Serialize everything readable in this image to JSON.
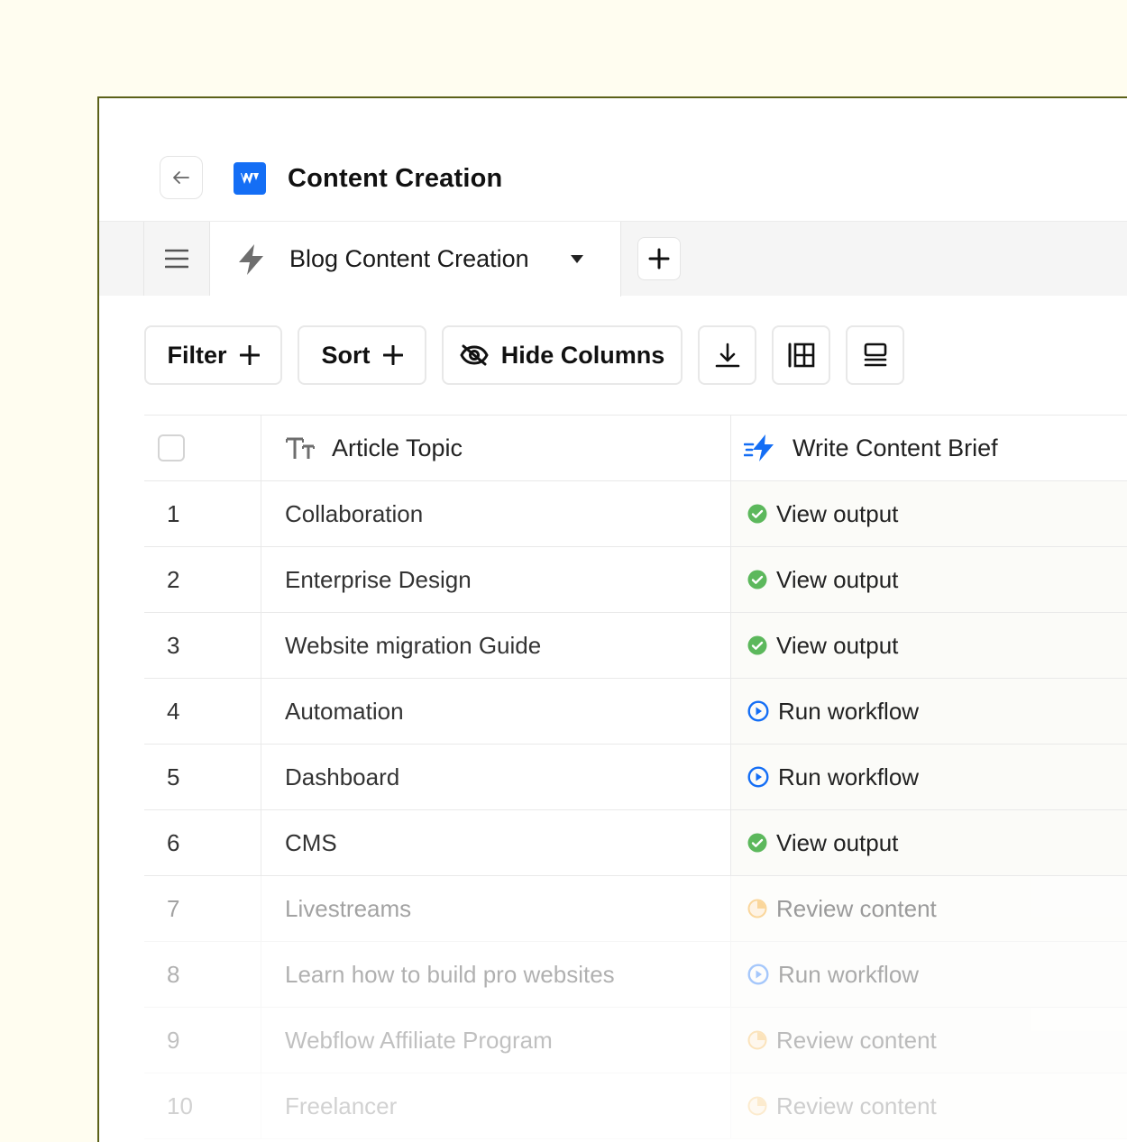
{
  "header": {
    "back_icon": "arrow-left-icon",
    "logo_icon": "webflow-logo-icon",
    "title": "Content Creation"
  },
  "tabs": {
    "menu_icon": "hamburger-menu-icon",
    "active": {
      "icon": "bolt-icon",
      "label": "Blog Content Creation",
      "dropdown_icon": "caret-down-icon"
    },
    "add_icon": "plus-icon"
  },
  "toolbar": {
    "filter_label": "Filter",
    "sort_label": "Sort",
    "hide_columns_label": "Hide Columns",
    "download_icon": "download-icon",
    "columns_icon": "columns-icon",
    "rows_icon": "row-height-icon"
  },
  "table": {
    "columns": [
      {
        "label": "",
        "icon": "checkbox"
      },
      {
        "label": "Article Topic",
        "icon": "text-type-icon"
      },
      {
        "label": "Write Content Brief",
        "icon": "fast-bolt-icon"
      }
    ],
    "rows": [
      {
        "num": "1",
        "topic": "Collaboration",
        "status": "View output",
        "status_type": "done"
      },
      {
        "num": "2",
        "topic": "Enterprise Design",
        "status": "View output",
        "status_type": "done"
      },
      {
        "num": "3",
        "topic": "Website migration Guide",
        "status": "View output",
        "status_type": "done"
      },
      {
        "num": "4",
        "topic": "Automation",
        "status": "Run workflow",
        "status_type": "run"
      },
      {
        "num": "5",
        "topic": "Dashboard",
        "status": "Run workflow",
        "status_type": "run"
      },
      {
        "num": "6",
        "topic": "CMS",
        "status": "View output",
        "status_type": "done"
      },
      {
        "num": "7",
        "topic": "Livestreams",
        "status": "Review content",
        "status_type": "review"
      },
      {
        "num": "8",
        "topic": "Learn how to build pro websites",
        "status": "Run workflow",
        "status_type": "run"
      },
      {
        "num": "9",
        "topic": "Webflow Affiliate Program",
        "status": "Review content",
        "status_type": "review"
      },
      {
        "num": "10",
        "topic": "Freelancer",
        "status": "Review content",
        "status_type": "review"
      }
    ]
  },
  "colors": {
    "accent_blue": "#146ef5",
    "done_green": "#5cb85c",
    "review_orange": "#f5a623",
    "frame_border": "#5b6118",
    "background": "#fffdf0"
  }
}
